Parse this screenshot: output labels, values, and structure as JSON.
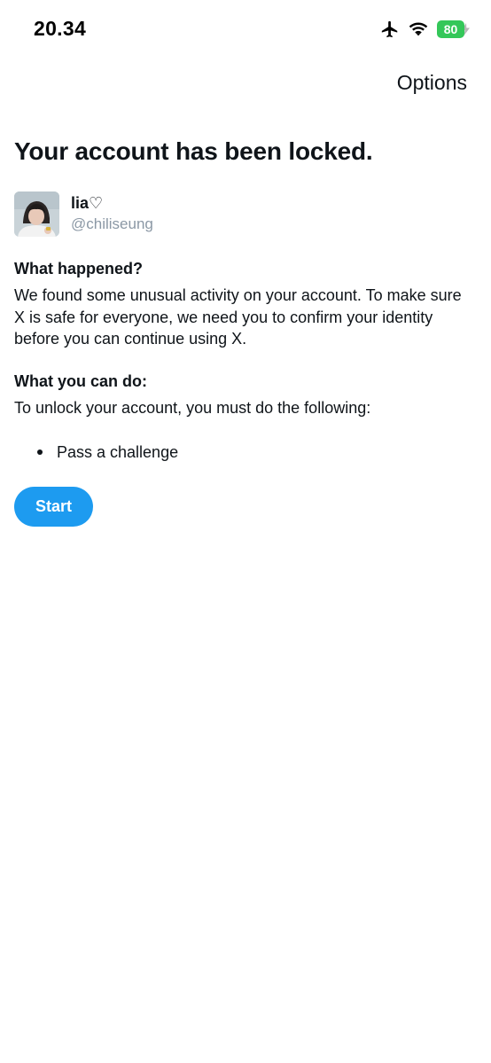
{
  "status_bar": {
    "time": "20.34",
    "battery": "80",
    "icons": [
      "airplane-icon",
      "wifi-icon",
      "battery-charging-icon"
    ],
    "battery_color": "#34c759"
  },
  "header": {
    "options_label": "Options"
  },
  "title": "Your account has been locked.",
  "account": {
    "display_name": "lia♡",
    "handle": "@chiliseung"
  },
  "what_happened": {
    "heading": "What happened?",
    "body": "We found some unusual activity on your account. To make sure X is safe for everyone, we need you to confirm your identity before you can continue using X."
  },
  "what_you_can_do": {
    "heading": "What you can do:",
    "body": "To unlock your account, you must do the following:",
    "steps": [
      "Pass a challenge"
    ]
  },
  "start_label": "Start",
  "colors": {
    "accent": "#1d9bf0",
    "text": "#0f1419",
    "secondary_text": "#8b98a5"
  }
}
